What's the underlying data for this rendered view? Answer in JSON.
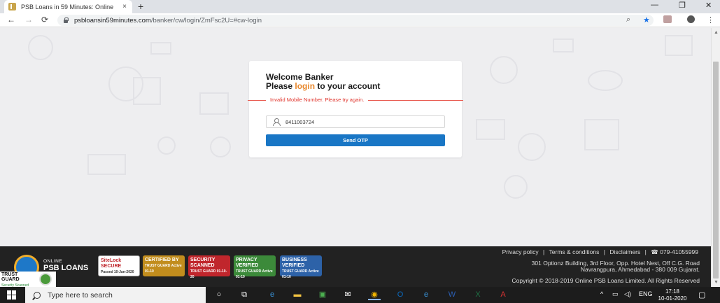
{
  "browser": {
    "tab_title": "PSB Loans in 59 Minutes: Online",
    "tab_close": "×",
    "new_tab": "+",
    "url_host": "psbloansin59minutes.com",
    "url_path": "/banker/cw/login/ZmFsc2U=#cw-login",
    "win_min": "—",
    "win_restore": "❐",
    "win_close": "✕",
    "back": "←",
    "forward": "→",
    "reload": "⟳",
    "zoom_icon": "search-icon",
    "star": "★",
    "menu": "⋮"
  },
  "login": {
    "welcome": "Welcome Banker",
    "please": "Please ",
    "login_word": "login",
    "to_account": " to your account",
    "error": "Invalid Mobile Number. Please try again.",
    "mobile_value": "8411003724",
    "send_otp": "Send OTP",
    "accent_color": "#e8862a",
    "button_color": "#1976c5"
  },
  "footer": {
    "brand_small": "ONLINE",
    "brand_big": "PSB LOANS",
    "badges": [
      {
        "label": "SiteLock SECURE",
        "sub": "Passed 10-Jan-2020"
      },
      {
        "label": "CERTIFIED BY",
        "sub": "TRUST GUARD Active 01-10"
      },
      {
        "label": "SECURITY SCANNED",
        "sub": "TRUST GUARD 01-10-20"
      },
      {
        "label": "PRIVACY VERIFIED",
        "sub": "TRUST GUARD Active 01-10"
      },
      {
        "label": "BUSINESS VERIFIED",
        "sub": "TRUST GUARD Active 01-10"
      }
    ],
    "trust_line1": "TRUST",
    "trust_line2": "GUARD",
    "trust_sub": "Security Scanned",
    "links": [
      "Privacy policy",
      "Terms & conditions",
      "Disclaimers"
    ],
    "separator": "|",
    "phone": "☎ 079-41055999",
    "address_line1": "301 Optionz Building, 3rd Floor, Opp. Hotel Nest, Off C.G. Road",
    "address_line2": "Navrangpura, Ahmedabad - 380 009 Gujarat.",
    "copyright": "Copyright © 2018-2019 Online PSB Loans Limited. All Rights Reserved"
  },
  "taskbar": {
    "search_placeholder": "Type here to search",
    "tray_lang": "ENG",
    "time": "17:18",
    "date": "10-01-2020"
  }
}
